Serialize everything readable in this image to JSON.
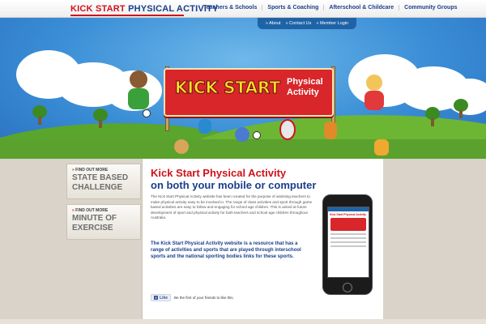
{
  "header": {
    "logo_part1": "KICK START",
    "logo_part2": "PHYSICAL ACTIVITY",
    "menu": [
      "Teachers & Schools",
      "Sports & Coaching",
      "Afterschool & Childcare",
      "Community Groups"
    ]
  },
  "subnav": [
    "» About",
    "» Contact Us",
    "» Member Login"
  ],
  "hero": {
    "banner_title": "KICK START",
    "banner_sub": "Physical Activity"
  },
  "sidebar": {
    "boxes": [
      {
        "find": "FIND OUT MORE",
        "title_line1": "STATE BASED",
        "title_line2": "CHALLENGE"
      },
      {
        "find": "FIND OUT MORE",
        "title_line1": "MINUTE OF",
        "title_line2": "EXERCISE"
      }
    ]
  },
  "main": {
    "title": "Kick Start Physical Activity",
    "subtitle": "on both your mobile or computer",
    "body": "The Kick Start Physical Activity website has been created for the purpose of assisting teachers to make physical activity easy to be involved in. The range of class activities and sport through game based activities are easy to follow and engaging for school age children. This is aimed at future development of sport and physical activity for both teachers and school age children throughout Australia.",
    "highlight": "The Kick Start Physical Activity website is a resource that has a range of activities and sports that are played through interschool sports and the national sporting bodies links for these sports.",
    "fb_like": "Like",
    "fb_text": "Be the first of your friends to like this.",
    "phone_title": "Kick Start Physical Activity"
  },
  "colors": {
    "brand_red": "#d0121b",
    "brand_blue": "#1a3e8a",
    "sky": "#3a8ed6",
    "grass": "#5ba12e"
  }
}
